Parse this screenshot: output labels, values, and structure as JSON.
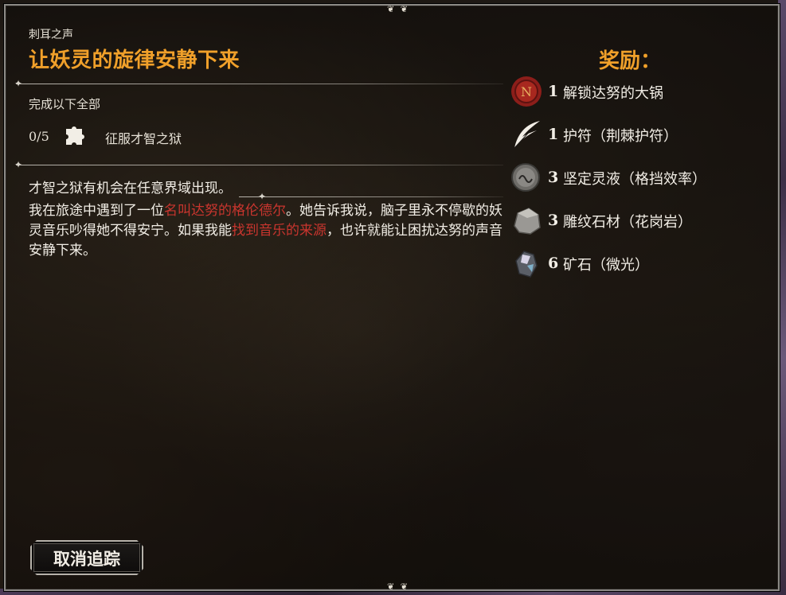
{
  "quest": {
    "category": "刺耳之声",
    "title": "让妖灵的旋律安静下来"
  },
  "objectives": {
    "header": "完成以下全部",
    "items": [
      {
        "count": "0/5",
        "icon": "puzzle-icon",
        "label": "征服才智之狱"
      }
    ]
  },
  "description": {
    "line1": "才智之狱有机会在任意界域出现。",
    "p2_a": "我在旅途中遇到了一位",
    "p2_hl1": "名叫达努的格伦德尔",
    "p2_b": "。她告诉我说，脑子里永不停歇的妖灵音乐吵得她不得安宁。如果我能",
    "p2_hl2": "找到音乐的来源",
    "p2_c": "，也许就能让困扰达努的声音安静下来。"
  },
  "rewards": {
    "title": "奖励：",
    "items": [
      {
        "icon": "wax-seal-icon",
        "qty": "1",
        "name": "解锁达努的大锅"
      },
      {
        "icon": "feather-icon",
        "qty": "1",
        "name": "护符（荆棘护符）"
      },
      {
        "icon": "essence-coin-icon",
        "qty": "3",
        "name": "坚定灵液（格挡效率）"
      },
      {
        "icon": "stone-icon",
        "qty": "3",
        "name": "雕纹石材（花岗岩）"
      },
      {
        "icon": "ore-icon",
        "qty": "6",
        "name": "矿石（微光）"
      }
    ]
  },
  "buttons": {
    "untrack": "取消追踪"
  },
  "colors": {
    "accent": "#f0a02a",
    "highlight": "#c9352e",
    "text": "#f2eee6"
  }
}
